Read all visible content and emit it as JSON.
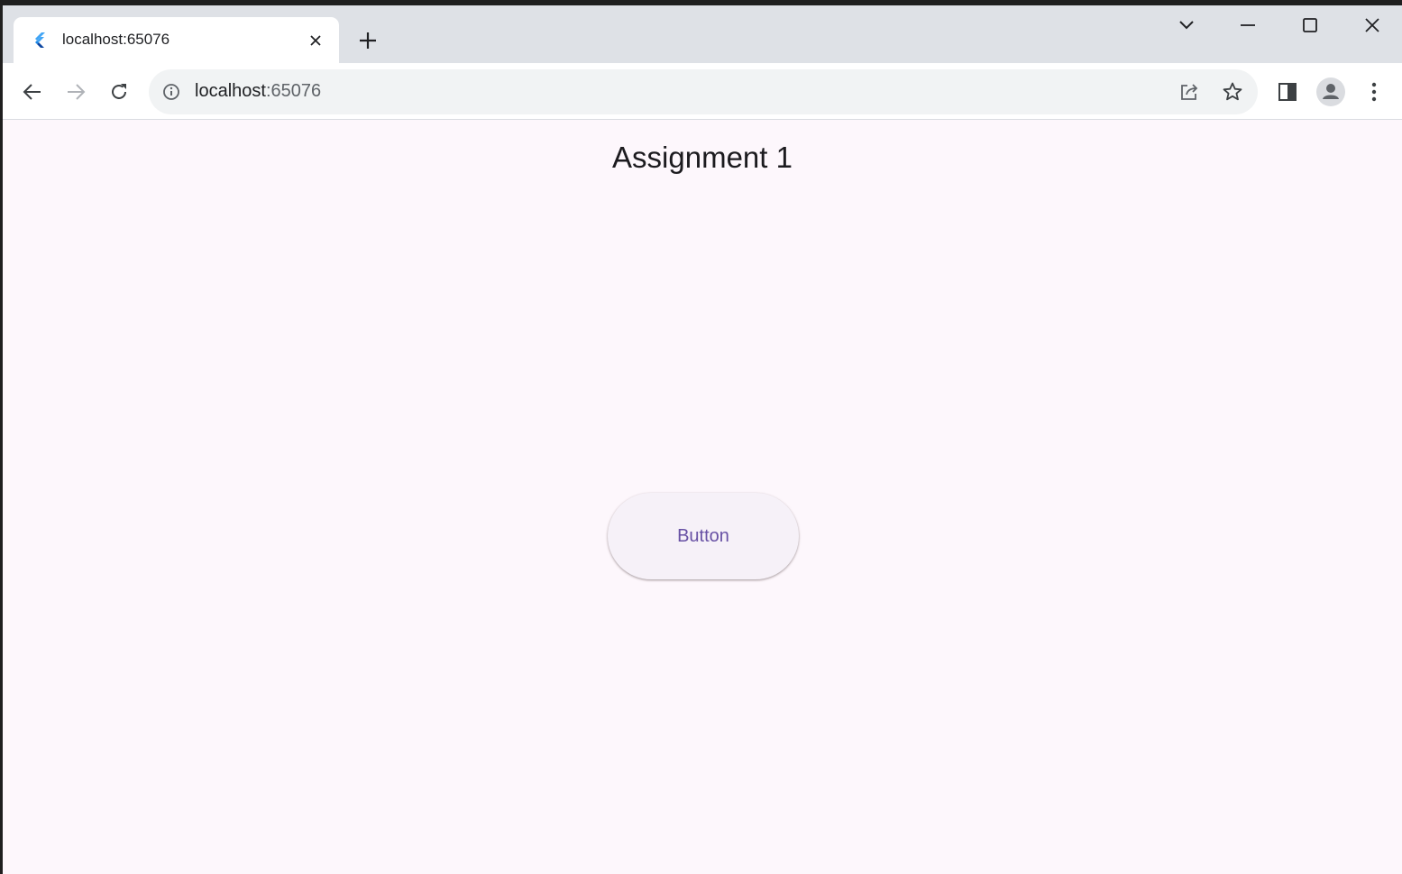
{
  "browser": {
    "tab": {
      "title": "localhost:65076",
      "favicon": "flutter-icon"
    },
    "new_tab_icon": "plus-icon",
    "window_controls": [
      "tab-search-icon",
      "minimize-icon",
      "maximize-icon",
      "close-icon"
    ],
    "omnibox": {
      "host": "localhost",
      "port": ":65076"
    }
  },
  "page": {
    "title": "Assignment 1",
    "button_label": "Button"
  },
  "colors": {
    "background": "#fdf7fc",
    "button_background": "#f6f1f8",
    "button_text": "#6750a4",
    "tab_strip": "#dee1e6"
  }
}
